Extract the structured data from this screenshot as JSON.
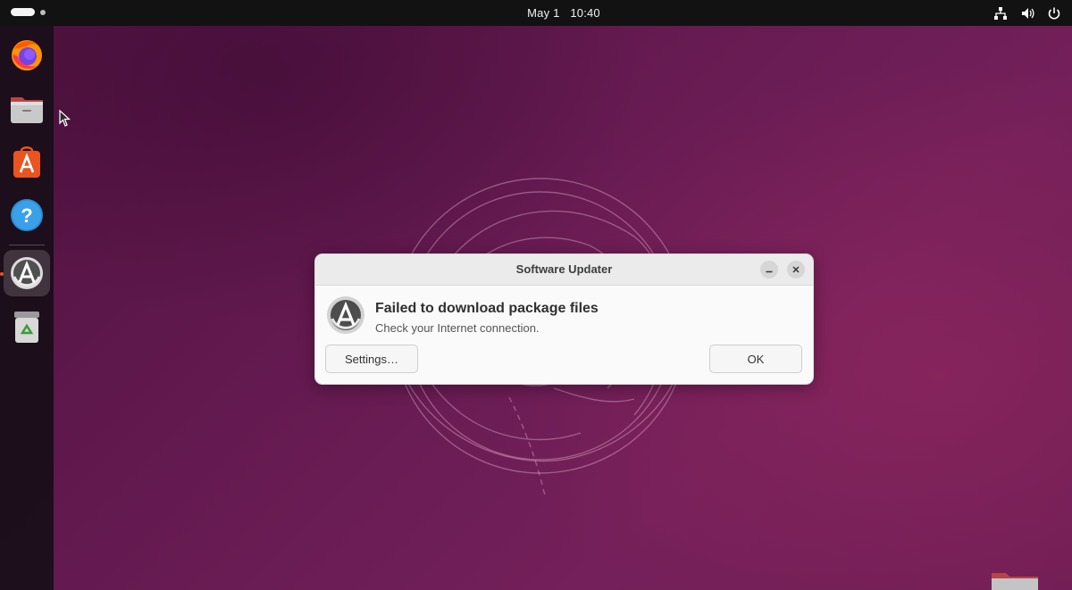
{
  "topbar": {
    "date": "May 1",
    "time": "10:40",
    "tray_icons": [
      "network-icon",
      "volume-icon",
      "power-icon"
    ]
  },
  "dock": {
    "items": [
      {
        "name": "firefox",
        "icon": "firefox-icon"
      },
      {
        "name": "files",
        "icon": "files-icon"
      },
      {
        "name": "app-center",
        "icon": "app-center-icon"
      },
      {
        "name": "help",
        "icon": "help-icon"
      },
      {
        "name": "software-updater",
        "icon": "software-updater-icon",
        "active": true
      },
      {
        "name": "trash",
        "icon": "trash-icon"
      }
    ]
  },
  "dialog": {
    "title": "Software Updater",
    "message_title": "Failed to download package files",
    "message_detail": "Check your Internet connection.",
    "settings_button": "Settings…",
    "ok_button": "OK"
  },
  "colors": {
    "accent": "#e95420",
    "topbar": "#121212",
    "dock": "#180e18",
    "wallpaper": "#641a50"
  }
}
